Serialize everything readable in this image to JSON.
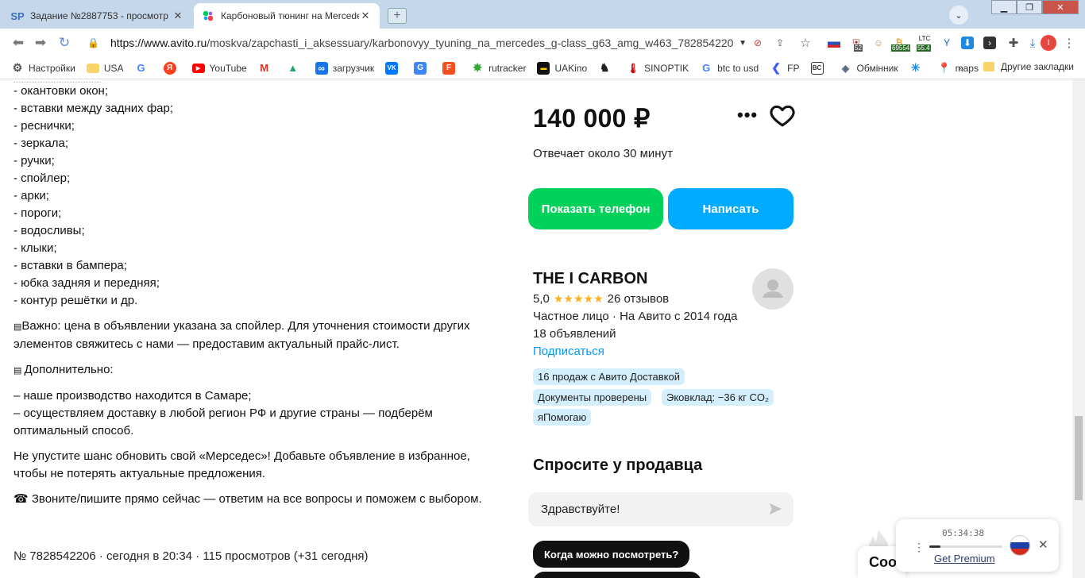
{
  "browser": {
    "tabs": [
      {
        "icon": "SP",
        "title": "Задание №2887753 - просмотр з...",
        "active": false
      },
      {
        "icon": "avito-icon",
        "title": "Карбоновый тюнинг на Mercede...",
        "active": true
      }
    ],
    "url_prefix": "https://www.avito.ru",
    "url_rest": "/moskva/zapchasti_i_aksessuary/karbonovyy_tyuning_na_mercedes_g-class_g63_amg_w463_7828542206?...",
    "extensions": {
      "badge_52": "52",
      "btc": "69554",
      "ltc_label": "LTC",
      "ltc": "55.4",
      "profile_initial": "I"
    },
    "bookmarks": [
      "Настройки",
      "USA",
      "",
      "",
      "YouTube",
      "",
      "",
      "загрузчик",
      "",
      "",
      "",
      "rutracker",
      "UAKino",
      "",
      "SINOPTIK",
      "btc to usd",
      "FP",
      "",
      "Обмінник",
      "",
      "maps"
    ],
    "bookmarks_more": "»",
    "other_bookmarks": "Другие закладки"
  },
  "listing": {
    "items": [
      "- окантовки окон;",
      "- вставки между задних фар;",
      "- реснички;",
      "- зеркала;",
      "- ручки;",
      "- спойлер;",
      "- арки;",
      "- пороги;",
      "- водосливы;",
      "- клыки;",
      "- вставки в бампера;",
      "- юбка задняя и передняя;",
      "- контур решётки и др."
    ],
    "important": "Важно: цена в объявлении указана за спойлер. Для уточнения стоимости других элементов свяжитесь с нами — предоставим актуальный прайс-лист.",
    "additional_title": "Дополнительно:",
    "additional_1": "– наше производство находится в Самаре;",
    "additional_2": "– осуществляем доставку в любой регион РФ и другие страны — подберём оптимальный способ.",
    "cta": "Не упустите шанс обновить свой «Мерседес»! Добавьте объявление в избранное, чтобы не потерять актуальные предложения.",
    "call": "☎ Звоните/пишите прямо сейчас — ответим на все вопросы и поможем с выбором.",
    "meta": "№ 7828542206 · сегодня в 20:34 · 115 просмотров (+31 сегодня)"
  },
  "sidebar": {
    "price": "140 000 ₽",
    "responds": "Отвечает около 30 минут",
    "show_phone": "Показать телефон",
    "write": "Написать",
    "seller_name": "THE I CARBON",
    "rating": "5,0",
    "stars": "★★★★★",
    "reviews": "26 отзывов",
    "seller_type": "Частное лицо · На Авито с 2014 года",
    "ads_count": "18 объявлений",
    "subscribe": "Подписаться",
    "chips": [
      "16 продаж с Авито Доставкой",
      "Документы проверены",
      "Эковклад: −36 кг CO₂",
      "яПомогаю"
    ],
    "ask_title": "Спросите у продавца",
    "message_default": "Здравствуйте!",
    "quick_question": "Когда можно посмотреть?"
  },
  "cookie_text": "Coo",
  "player": {
    "time": "05:34:38",
    "progress": 0.15,
    "premium": "Get Premium"
  },
  "colors": {
    "green": "#02d15c",
    "blue": "#00aaff",
    "link": "#0099f7",
    "star": "#ffb021",
    "chip": "#d3eefc"
  }
}
